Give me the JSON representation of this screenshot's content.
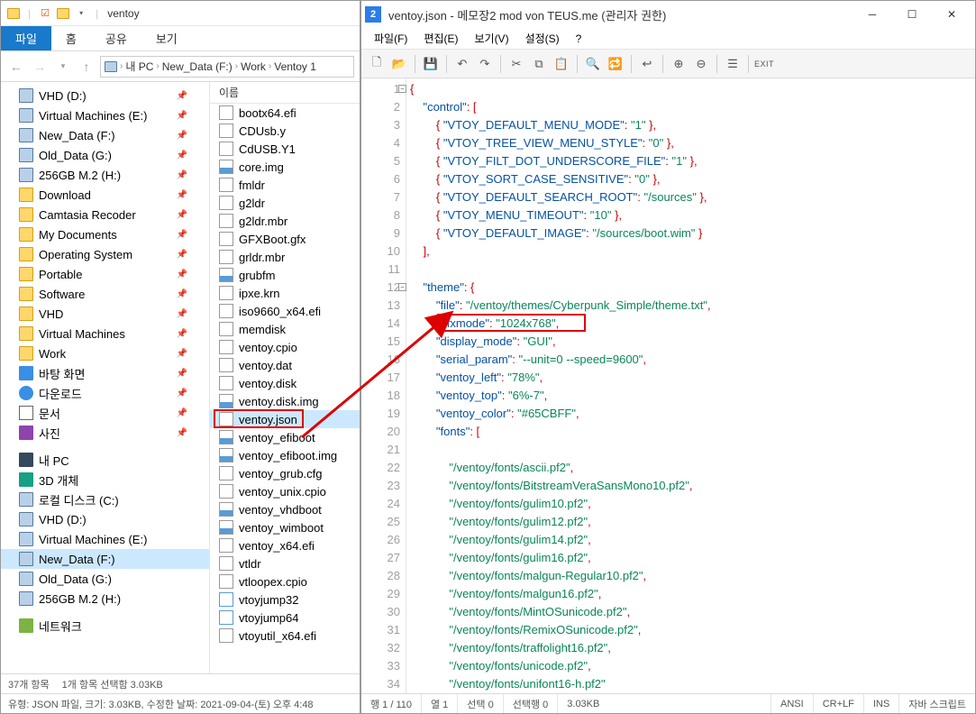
{
  "explorer": {
    "window_title": "ventoy",
    "ribbon": {
      "file": "파일",
      "home": "홈",
      "share": "공유",
      "view": "보기"
    },
    "breadcrumb": [
      "내 PC",
      "New_Data (F:)",
      "Work",
      "Ventoy 1"
    ],
    "tree": [
      {
        "label": "VHD (D:)",
        "icon": "drive",
        "pin": true
      },
      {
        "label": "Virtual Machines (E:)",
        "icon": "drive",
        "pin": true
      },
      {
        "label": "New_Data (F:)",
        "icon": "drive",
        "pin": true
      },
      {
        "label": "Old_Data (G:)",
        "icon": "drive",
        "pin": true
      },
      {
        "label": "256GB M.2 (H:)",
        "icon": "drive",
        "pin": true
      },
      {
        "label": "Download",
        "icon": "folder",
        "pin": true
      },
      {
        "label": "Camtasia Recoder",
        "icon": "folder",
        "pin": true
      },
      {
        "label": "My Documents",
        "icon": "folder",
        "pin": true
      },
      {
        "label": "Operating System",
        "icon": "folder",
        "pin": true
      },
      {
        "label": "Portable",
        "icon": "folder",
        "pin": true
      },
      {
        "label": "Software",
        "icon": "folder",
        "pin": true
      },
      {
        "label": "VHD",
        "icon": "folder",
        "pin": true
      },
      {
        "label": "Virtual Machines",
        "icon": "folder",
        "pin": true
      },
      {
        "label": "Work",
        "icon": "folder",
        "pin": true
      },
      {
        "label": "바탕 화면",
        "icon": "desktop",
        "pin": true
      },
      {
        "label": "다운로드",
        "icon": "down",
        "pin": true
      },
      {
        "label": "문서",
        "icon": "doc-ico",
        "pin": true
      },
      {
        "label": "사진",
        "icon": "pic",
        "pin": true
      },
      {
        "label": "내 PC",
        "icon": "pc",
        "pin": false,
        "sep_before": true
      },
      {
        "label": "3D 개체",
        "icon": "3d",
        "pin": false
      },
      {
        "label": "로컬 디스크 (C:)",
        "icon": "drive",
        "pin": false
      },
      {
        "label": "VHD (D:)",
        "icon": "drive",
        "pin": false
      },
      {
        "label": "Virtual Machines (E:)",
        "icon": "drive",
        "pin": false
      },
      {
        "label": "New_Data (F:)",
        "icon": "drive",
        "pin": false,
        "sel": true
      },
      {
        "label": "Old_Data (G:)",
        "icon": "drive",
        "pin": false
      },
      {
        "label": "256GB M.2 (H:)",
        "icon": "drive",
        "pin": false
      },
      {
        "label": "네트워크",
        "icon": "net",
        "pin": false,
        "sep_before": true
      }
    ],
    "list_header": "이름",
    "files": [
      {
        "name": "bootx64.efi",
        "ico": "file"
      },
      {
        "name": "CDUsb.y",
        "ico": "file"
      },
      {
        "name": "CdUSB.Y1",
        "ico": "file"
      },
      {
        "name": "core.img",
        "ico": "img"
      },
      {
        "name": "fmldr",
        "ico": "file"
      },
      {
        "name": "g2ldr",
        "ico": "file"
      },
      {
        "name": "g2ldr.mbr",
        "ico": "file"
      },
      {
        "name": "GFXBoot.gfx",
        "ico": "file"
      },
      {
        "name": "grldr.mbr",
        "ico": "file"
      },
      {
        "name": "grubfm",
        "ico": "img"
      },
      {
        "name": "ipxe.krn",
        "ico": "file"
      },
      {
        "name": "iso9660_x64.efi",
        "ico": "file"
      },
      {
        "name": "memdisk",
        "ico": "file"
      },
      {
        "name": "ventoy.cpio",
        "ico": "file"
      },
      {
        "name": "ventoy.dat",
        "ico": "file"
      },
      {
        "name": "ventoy.disk",
        "ico": "file"
      },
      {
        "name": "ventoy.disk.img",
        "ico": "img"
      },
      {
        "name": "ventoy.json",
        "ico": "file",
        "sel": true,
        "redbox": true
      },
      {
        "name": "ventoy_efiboot",
        "ico": "img"
      },
      {
        "name": "ventoy_efiboot.img",
        "ico": "img"
      },
      {
        "name": "ventoy_grub.cfg",
        "ico": "file"
      },
      {
        "name": "ventoy_unix.cpio",
        "ico": "file"
      },
      {
        "name": "ventoy_vhdboot",
        "ico": "img"
      },
      {
        "name": "ventoy_wimboot",
        "ico": "img"
      },
      {
        "name": "ventoy_x64.efi",
        "ico": "file"
      },
      {
        "name": "vtldr",
        "ico": "file"
      },
      {
        "name": "vtloopex.cpio",
        "ico": "file"
      },
      {
        "name": "vtoyjump32",
        "ico": "exe"
      },
      {
        "name": "vtoyjump64",
        "ico": "exe"
      },
      {
        "name": "vtoyutil_x64.efi",
        "ico": "file"
      }
    ],
    "status1_left": "37개 항목",
    "status1_right": "1개 항목 선택함 3.03KB",
    "status2": "유형: JSON 파일, 크기: 3.03KB, 수정한 날짜: 2021-09-04-(토) 오후 4:48"
  },
  "editor": {
    "title": "ventoy.json - 메모장2 mod von TEUS.me (관리자 권한)",
    "menu": [
      {
        "label": "파일(F)"
      },
      {
        "label": "편집(E)"
      },
      {
        "label": "보기(V)"
      },
      {
        "label": "설정(S)"
      },
      {
        "label": "?"
      }
    ],
    "code_lines": [
      {
        "n": 1,
        "html": "<span class='tok-pun'>{</span>"
      },
      {
        "n": 2,
        "html": "    <span class='tok-key'>\"control\"</span><span class='tok-pun'>: [</span>"
      },
      {
        "n": 3,
        "html": "        <span class='tok-pun'>{</span> <span class='tok-key'>\"VTOY_DEFAULT_MENU_MODE\"</span><span class='tok-pun'>:</span> <span class='tok-str'>\"1\"</span> <span class='tok-pun'>},</span>"
      },
      {
        "n": 4,
        "html": "        <span class='tok-pun'>{</span> <span class='tok-key'>\"VTOY_TREE_VIEW_MENU_STYLE\"</span><span class='tok-pun'>:</span> <span class='tok-str'>\"0\"</span> <span class='tok-pun'>},</span>"
      },
      {
        "n": 5,
        "html": "        <span class='tok-pun'>{</span> <span class='tok-key'>\"VTOY_FILT_DOT_UNDERSCORE_FILE\"</span><span class='tok-pun'>:</span> <span class='tok-str'>\"1\"</span> <span class='tok-pun'>},</span>"
      },
      {
        "n": 6,
        "html": "        <span class='tok-pun'>{</span> <span class='tok-key'>\"VTOY_SORT_CASE_SENSITIVE\"</span><span class='tok-pun'>:</span> <span class='tok-str'>\"0\"</span> <span class='tok-pun'>},</span>"
      },
      {
        "n": 7,
        "html": "        <span class='tok-pun'>{</span> <span class='tok-key'>\"VTOY_DEFAULT_SEARCH_ROOT\"</span><span class='tok-pun'>:</span> <span class='tok-str'>\"/sources\"</span> <span class='tok-pun'>},</span>"
      },
      {
        "n": 8,
        "html": "        <span class='tok-pun'>{</span> <span class='tok-key'>\"VTOY_MENU_TIMEOUT\"</span><span class='tok-pun'>:</span> <span class='tok-str'>\"10\"</span> <span class='tok-pun'>},</span>"
      },
      {
        "n": 9,
        "html": "        <span class='tok-pun'>{</span> <span class='tok-key'>\"VTOY_DEFAULT_IMAGE\"</span><span class='tok-pun'>:</span> <span class='tok-str'>\"/sources/boot.wim\"</span> <span class='tok-pun'>}</span>"
      },
      {
        "n": 10,
        "html": "    <span class='tok-pun'>],</span>"
      },
      {
        "n": 11,
        "html": ""
      },
      {
        "n": 12,
        "html": "    <span class='tok-key'>\"theme\"</span><span class='tok-pun'>: {</span>"
      },
      {
        "n": 13,
        "html": "        <span class='tok-key'>\"file\"</span><span class='tok-pun'>:</span> <span class='tok-str'>\"/ventoy/themes/Cyberpunk_Simple/theme.txt\"</span><span class='tok-pun'>,</span>"
      },
      {
        "n": 14,
        "html": "        <span class='tok-key'>\"gfxmode\"</span><span class='tok-pun'>:</span> <span class='tok-str'>\"1024x768\"</span><span class='tok-pun'>,</span>",
        "redbox": true
      },
      {
        "n": 15,
        "html": "        <span class='tok-key'>\"display_mode\"</span><span class='tok-pun'>:</span> <span class='tok-str'>\"GUI\"</span><span class='tok-pun'>,</span>"
      },
      {
        "n": 16,
        "html": "        <span class='tok-key'>\"serial_param\"</span><span class='tok-pun'>:</span> <span class='tok-str'>\"--unit=0 --speed=9600\"</span><span class='tok-pun'>,</span>"
      },
      {
        "n": 17,
        "html": "        <span class='tok-key'>\"ventoy_left\"</span><span class='tok-pun'>:</span> <span class='tok-str'>\"78%\"</span><span class='tok-pun'>,</span>"
      },
      {
        "n": 18,
        "html": "        <span class='tok-key'>\"ventoy_top\"</span><span class='tok-pun'>:</span> <span class='tok-str'>\"6%-7\"</span><span class='tok-pun'>,</span>"
      },
      {
        "n": 19,
        "html": "        <span class='tok-key'>\"ventoy_color\"</span><span class='tok-pun'>:</span> <span class='tok-str'>\"#65CBFF\"</span><span class='tok-pun'>,</span>"
      },
      {
        "n": 20,
        "html": "        <span class='tok-key'>\"fonts\"</span><span class='tok-pun'>: [</span>"
      },
      {
        "n": 21,
        "html": ""
      },
      {
        "n": 22,
        "html": "            <span class='tok-str'>\"/ventoy/fonts/ascii.pf2\"</span><span class='tok-pun'>,</span>"
      },
      {
        "n": 23,
        "html": "            <span class='tok-str'>\"/ventoy/fonts/BitstreamVeraSansMono10.pf2\"</span><span class='tok-pun'>,</span>"
      },
      {
        "n": 24,
        "html": "            <span class='tok-str'>\"/ventoy/fonts/gulim10.pf2\"</span><span class='tok-pun'>,</span>"
      },
      {
        "n": 25,
        "html": "            <span class='tok-str'>\"/ventoy/fonts/gulim12.pf2\"</span><span class='tok-pun'>,</span>"
      },
      {
        "n": 26,
        "html": "            <span class='tok-str'>\"/ventoy/fonts/gulim14.pf2\"</span><span class='tok-pun'>,</span>"
      },
      {
        "n": 27,
        "html": "            <span class='tok-str'>\"/ventoy/fonts/gulim16.pf2\"</span><span class='tok-pun'>,</span>"
      },
      {
        "n": 28,
        "html": "            <span class='tok-str'>\"/ventoy/fonts/malgun-Regular10.pf2\"</span><span class='tok-pun'>,</span>"
      },
      {
        "n": 29,
        "html": "            <span class='tok-str'>\"/ventoy/fonts/malgun16.pf2\"</span><span class='tok-pun'>,</span>"
      },
      {
        "n": 30,
        "html": "            <span class='tok-str'>\"/ventoy/fonts/MintOSunicode.pf2\"</span><span class='tok-pun'>,</span>"
      },
      {
        "n": 31,
        "html": "            <span class='tok-str'>\"/ventoy/fonts/RemixOSunicode.pf2\"</span><span class='tok-pun'>,</span>"
      },
      {
        "n": 32,
        "html": "            <span class='tok-str'>\"/ventoy/fonts/traffolight16.pf2\"</span><span class='tok-pun'>,</span>"
      },
      {
        "n": 33,
        "html": "            <span class='tok-str'>\"/ventoy/fonts/unicode.pf2\"</span><span class='tok-pun'>,</span>"
      },
      {
        "n": 34,
        "html": "            <span class='tok-str'>\"/ventoy/fonts/unifont16-h.pf2\"</span>"
      }
    ],
    "status": {
      "pos": "행 1 / 110",
      "col": "열 1",
      "sel": "선택 0",
      "selrow": "선택행 0",
      "size": "3.03KB",
      "enc": "ANSI",
      "eol": "CR+LF",
      "ins": "INS",
      "scroll": "자바 스크립트"
    }
  }
}
